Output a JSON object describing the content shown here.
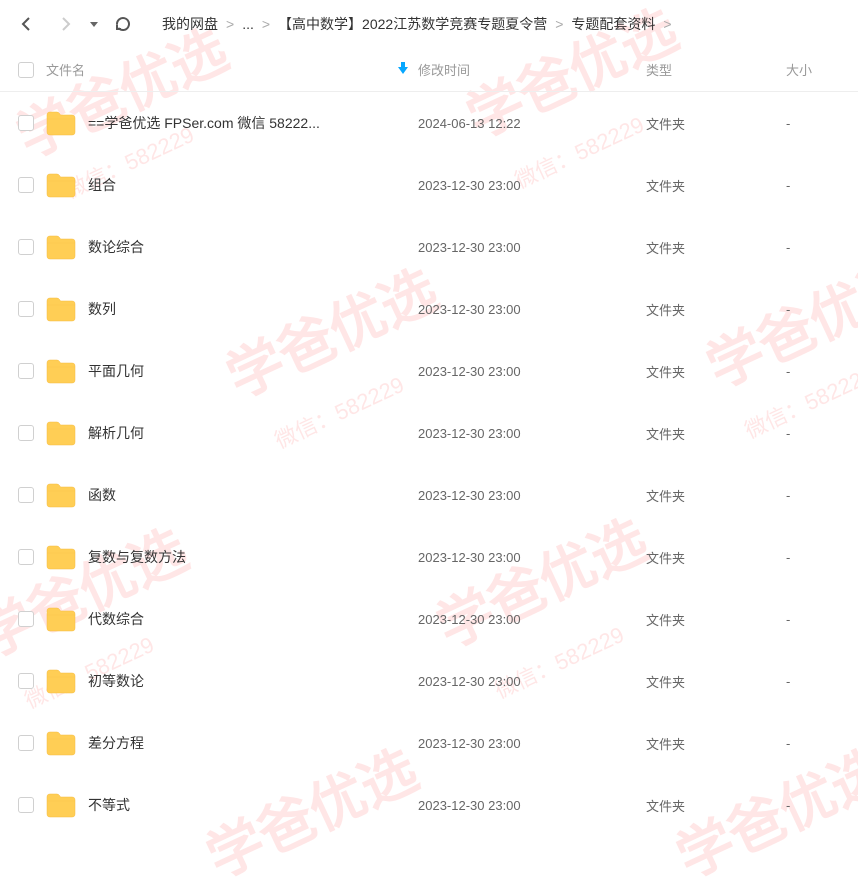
{
  "breadcrumb": {
    "root": "我的网盘",
    "ellipsis": "...",
    "mid": "【高中数学】2022江苏数学竞赛专题夏令营",
    "current": "专题配套资料"
  },
  "columns": {
    "name": "文件名",
    "date": "修改时间",
    "type": "类型",
    "size": "大小"
  },
  "type_folder": "文件夹",
  "size_dash": "-",
  "files": [
    {
      "name": "==学爸优选 FPSer.com 微信 58222...",
      "date": "2024-06-13 12:22"
    },
    {
      "name": "组合",
      "date": "2023-12-30 23:00"
    },
    {
      "name": "数论综合",
      "date": "2023-12-30 23:00"
    },
    {
      "name": "数列",
      "date": "2023-12-30 23:00"
    },
    {
      "name": "平面几何",
      "date": "2023-12-30 23:00"
    },
    {
      "name": "解析几何",
      "date": "2023-12-30 23:00"
    },
    {
      "name": "函数",
      "date": "2023-12-30 23:00"
    },
    {
      "name": "复数与复数方法",
      "date": "2023-12-30 23:00"
    },
    {
      "name": "代数综合",
      "date": "2023-12-30 23:00"
    },
    {
      "name": "初等数论",
      "date": "2023-12-30 23:00"
    },
    {
      "name": "差分方程",
      "date": "2023-12-30 23:00"
    },
    {
      "name": "不等式",
      "date": "2023-12-30 23:00"
    }
  ],
  "watermark": {
    "big": "学爸优选",
    "small": "微信：582229"
  }
}
